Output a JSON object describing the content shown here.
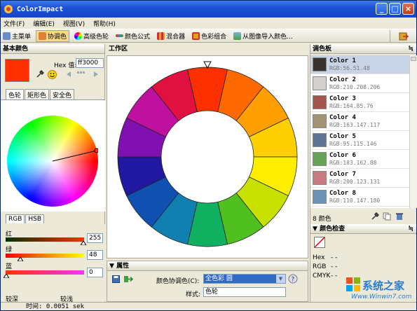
{
  "title": "ColorImpact",
  "window_buttons": {
    "min": "_",
    "max": "□",
    "close": "×"
  },
  "menu": [
    "文件(F)",
    "编辑(E)",
    "视图(V)",
    "帮助(H)"
  ],
  "toolbar": [
    {
      "label": "主菜单",
      "icon": "book-icon",
      "color": "#6a8cc7"
    },
    {
      "label": "协调色",
      "icon": "harmony-icon",
      "color": "#e08030",
      "active": true
    },
    {
      "label": "高级色轮",
      "icon": "advanced-wheel-icon",
      "color": "#c040c0"
    },
    {
      "label": "颜色公式",
      "icon": "formula-icon",
      "color": "#d04040"
    },
    {
      "label": "混合器",
      "icon": "mixer-icon",
      "color": "#d03030"
    },
    {
      "label": "色彩组合",
      "icon": "combo-icon",
      "color": "#e0a020"
    },
    {
      "label": "从图像导入颜色...",
      "icon": "image-import-icon",
      "color": "#4070b0"
    }
  ],
  "left": {
    "header": "基本颜色",
    "hex_label": "Hex 值:",
    "hex_value": "ff3000",
    "tabs": [
      "色轮",
      "矩形色",
      "安全色"
    ],
    "subtabs": [
      "RGB",
      "HSB"
    ],
    "sliders": [
      {
        "label": "红",
        "value": "255"
      },
      {
        "label": "绿",
        "value": "48"
      },
      {
        "label": "蓝",
        "value": "0"
      }
    ],
    "bottom_labels": [
      "较深",
      "较浅"
    ]
  },
  "work": {
    "header": "工作区"
  },
  "wheel_colors": [
    "#ff3000",
    "#ff6a00",
    "#ffa000",
    "#ffd000",
    "#ffee00",
    "#c8e000",
    "#50c020",
    "#10b060",
    "#1080b0",
    "#1050b0",
    "#2018a0",
    "#8010b0",
    "#c010a0",
    "#e01040"
  ],
  "props": {
    "header": "属性",
    "harmony_label": "颜色协调色(C):",
    "harmony_value": "全色彩 圆",
    "style_label": "样式:",
    "style_value": "色轮"
  },
  "palette": {
    "header": "调色板",
    "items": [
      {
        "name": "Color 1",
        "rgb": "RGB:56.51.48",
        "color": "#38332f",
        "selected": true
      },
      {
        "name": "Color 2",
        "rgb": "RGB:210.208.206",
        "color": "#d2d0ce"
      },
      {
        "name": "Color 3",
        "rgb": "RGB:164.85.76",
        "color": "#a4554c"
      },
      {
        "name": "Color 4",
        "rgb": "RGB:163.147.117",
        "color": "#a39375"
      },
      {
        "name": "Color 5",
        "rgb": "RGB:95.115.146",
        "color": "#5f7392"
      },
      {
        "name": "Color 6",
        "rgb": "RGB:103.162.88",
        "color": "#67a258"
      },
      {
        "name": "Color 7",
        "rgb": "RGB:200.123.131",
        "color": "#c87b83"
      },
      {
        "name": "Color 8",
        "rgb": "RGB:110.147.180",
        "color": "#6e93b4"
      }
    ],
    "count": "8 颜色"
  },
  "check": {
    "header": "颜色检查",
    "rows": [
      {
        "k": "Hex",
        "v": "- -"
      },
      {
        "k": "RGB",
        "v": "- -"
      },
      {
        "k": "CMYK",
        "v": "- -"
      }
    ]
  },
  "status": "时间: 0.0051 sek",
  "watermark": {
    "brand": "系统之家",
    "url": "Www.Winwin7.com"
  }
}
